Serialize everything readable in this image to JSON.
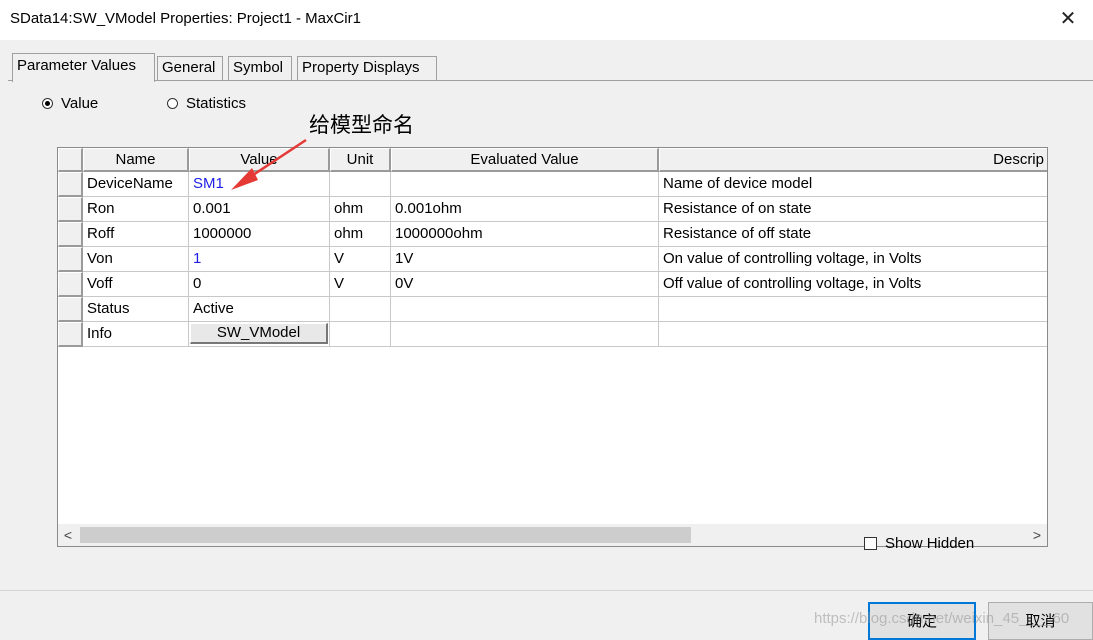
{
  "window": {
    "title": "SData14:SW_VModel Properties: Project1 - MaxCir1",
    "close_glyph": "✕"
  },
  "tabs": [
    {
      "label": "Parameter Values",
      "active": true
    },
    {
      "label": "General",
      "active": false
    },
    {
      "label": "Symbol",
      "active": false
    },
    {
      "label": "Property Displays",
      "active": false
    }
  ],
  "view_mode": {
    "options": [
      {
        "label": "Value",
        "checked": true
      },
      {
        "label": "Statistics",
        "checked": false
      }
    ]
  },
  "annotation": {
    "text": "给模型命名",
    "arrow_color": "#e53935"
  },
  "grid": {
    "columns": [
      "Name",
      "Value",
      "Unit",
      "Evaluated Value",
      "Descrip"
    ],
    "rows": [
      {
        "name": "DeviceName",
        "value": "SM1",
        "unit": "",
        "evaluated": "",
        "description": "Name of device model",
        "value_color": "blue"
      },
      {
        "name": "Ron",
        "value": "0.001",
        "unit": "ohm",
        "evaluated": "0.001ohm",
        "description": "Resistance of on state"
      },
      {
        "name": "Roff",
        "value": "1000000",
        "unit": "ohm",
        "evaluated": "1000000ohm",
        "description": "Resistance of off state"
      },
      {
        "name": "Von",
        "value": "1",
        "unit": "V",
        "evaluated": "1V",
        "description": "On value of controlling voltage, in Volts",
        "value_color": "blue"
      },
      {
        "name": "Voff",
        "value": "0",
        "unit": "V",
        "evaluated": "0V",
        "description": "Off value of controlling voltage, in Volts"
      },
      {
        "name": "Status",
        "value": "Active",
        "unit": "",
        "evaluated": "",
        "description": ""
      },
      {
        "name": "Info",
        "value": "SW_VModel",
        "unit": "",
        "evaluated": "",
        "description": "",
        "value_is_button": true
      }
    ],
    "scroll_left_glyph": "<",
    "scroll_right_glyph": ">"
  },
  "show_hidden": {
    "label": "Show Hidden",
    "checked": false
  },
  "buttons": {
    "ok": "确定",
    "cancel": "取消"
  },
  "watermark": "https://blog.csdn.net/weixin_45____60"
}
